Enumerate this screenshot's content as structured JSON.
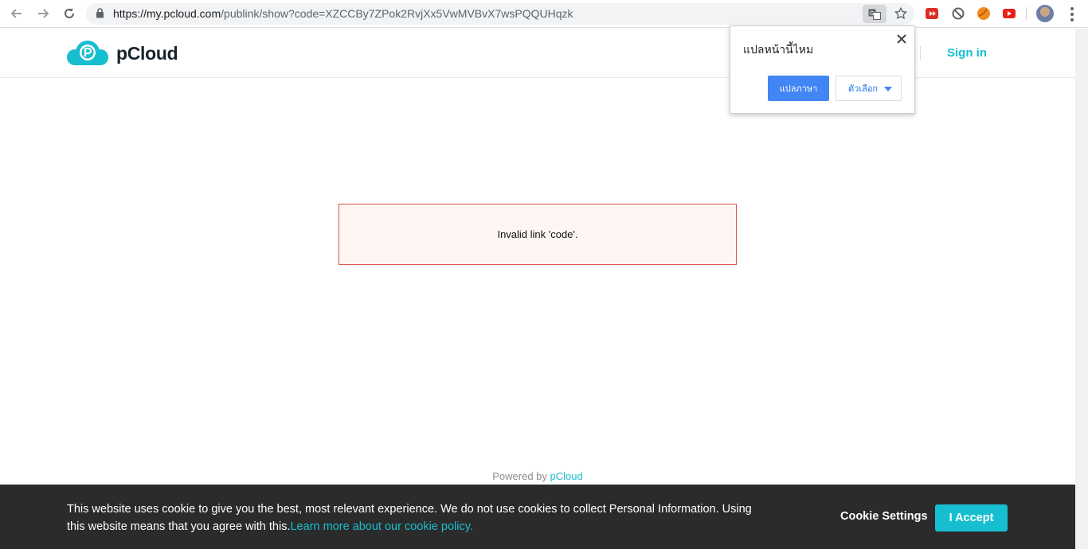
{
  "browser": {
    "url_host": "https://my.pcloud.com",
    "url_path": "/publink/show?code=XZCCBy7ZPok2RvjXx5VwMVBvX7wsPQQUHqzk"
  },
  "header": {
    "logo_text": "pCloud",
    "signin_label": "Sign in"
  },
  "translate_popup": {
    "title": "แปลหน้านี้ไหม",
    "translate_label": "แปลภาษา",
    "options_label": "ตัวเลือก"
  },
  "error": {
    "message": "Invalid link 'code'."
  },
  "footer": {
    "powered_prefix": "Powered by ",
    "powered_link": "pCloud"
  },
  "cookie": {
    "text": "This website uses cookie to give you the best, most relevant experience. We do not use cookies to collect Personal Information. Using this website means that you agree with this.",
    "link": "Learn more about our cookie policy.",
    "settings_label": "Cookie Settings",
    "accept_label": "I Accept"
  },
  "colors": {
    "brand": "#17bed0",
    "error_border": "#d9534f",
    "translate_blue": "#4285f4"
  }
}
